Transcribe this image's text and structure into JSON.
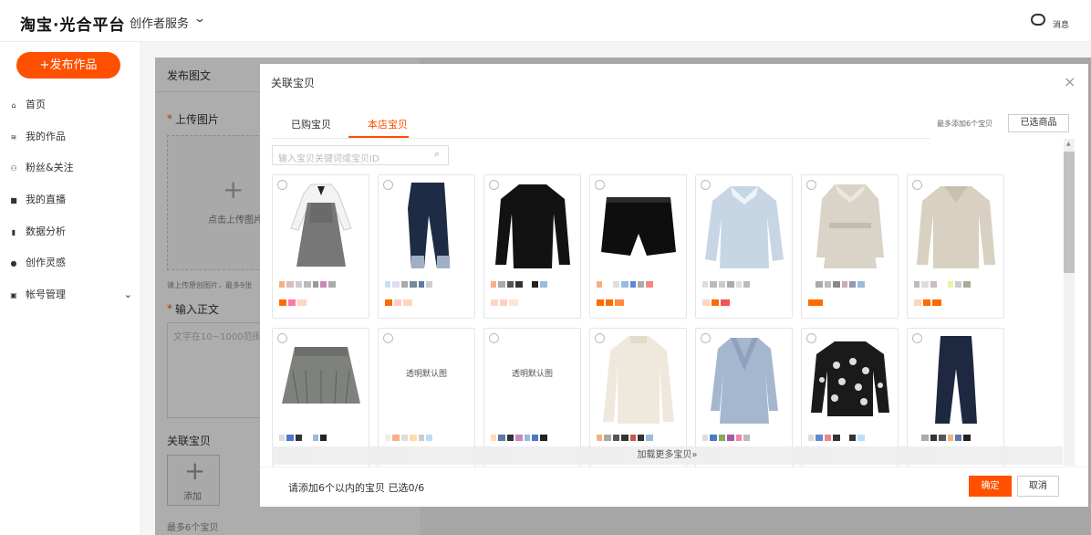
{
  "topbar": {
    "logo": "淘宝·光合平台",
    "service_menu": "创作者服务",
    "service_chevron": "⌄",
    "messages_label": "消息"
  },
  "sidebar": {
    "publish_button": "+发布作品",
    "items": [
      {
        "label": "首页",
        "icon": "home-icon",
        "glyph": "⌂"
      },
      {
        "label": "我的作品",
        "icon": "layers-icon",
        "glyph": "≋"
      },
      {
        "label": "粉丝&关注",
        "icon": "users-icon",
        "glyph": "⚇"
      },
      {
        "label": "我的直播",
        "icon": "video-icon",
        "glyph": "■"
      },
      {
        "label": "数据分析",
        "icon": "bar-chart-icon",
        "glyph": "▮"
      },
      {
        "label": "创作灵感",
        "icon": "bulb-icon",
        "glyph": "●"
      },
      {
        "label": "帐号管理",
        "icon": "account-icon",
        "glyph": "▣",
        "chevron": "⌄"
      }
    ]
  },
  "form": {
    "title": "发布图文",
    "upload_required": "*",
    "upload_label": "上传图片",
    "upload_plus": "+",
    "upload_hint": "点击上传图片",
    "upload_note": "请上传原创图片，最多9张",
    "body_required": "*",
    "body_label": "输入正文",
    "body_placeholder": "文字在10~1000范围",
    "related_label": "关联宝贝",
    "add_plus": "+",
    "add_label": "添加",
    "max_note": "最多6个宝贝"
  },
  "modal": {
    "title": "关联宝贝",
    "close": "×",
    "tabs": [
      {
        "label": "已购宝贝",
        "active": false
      },
      {
        "label": "本店宝贝",
        "active": true
      }
    ],
    "max_note": "最多添加6个宝贝",
    "selected_button": "已选商品",
    "search_placeholder": "输入宝贝关键词或宝贝ID",
    "search_icon": "⌕",
    "load_more": "加载更多宝贝»",
    "footer_hint": "请添加6个以内的宝贝 已选0/6",
    "confirm": "确定",
    "cancel": "取消",
    "scroll_up": "▲",
    "accent": "#ff5000"
  },
  "products": [
    {
      "image": "pinafore-dress-image",
      "placeholder": ""
    },
    {
      "image": "jeans-image",
      "placeholder": ""
    },
    {
      "image": "black-sweater-image",
      "placeholder": ""
    },
    {
      "image": "leather-shorts-image",
      "placeholder": ""
    },
    {
      "image": "blue-shirt-image",
      "placeholder": ""
    },
    {
      "image": "trench-coat-image",
      "placeholder": ""
    },
    {
      "image": "beige-sweater-image",
      "placeholder": ""
    },
    {
      "image": "pleated-skirt-image",
      "placeholder": ""
    },
    {
      "image": "",
      "placeholder": "透明默认图"
    },
    {
      "image": "",
      "placeholder": "透明默认图"
    },
    {
      "image": "cream-sweater-image",
      "placeholder": ""
    },
    {
      "image": "blue-blazer-image",
      "placeholder": ""
    },
    {
      "image": "patterned-sweater-image",
      "placeholder": ""
    },
    {
      "image": "dark-jeans-image",
      "placeholder": ""
    }
  ]
}
